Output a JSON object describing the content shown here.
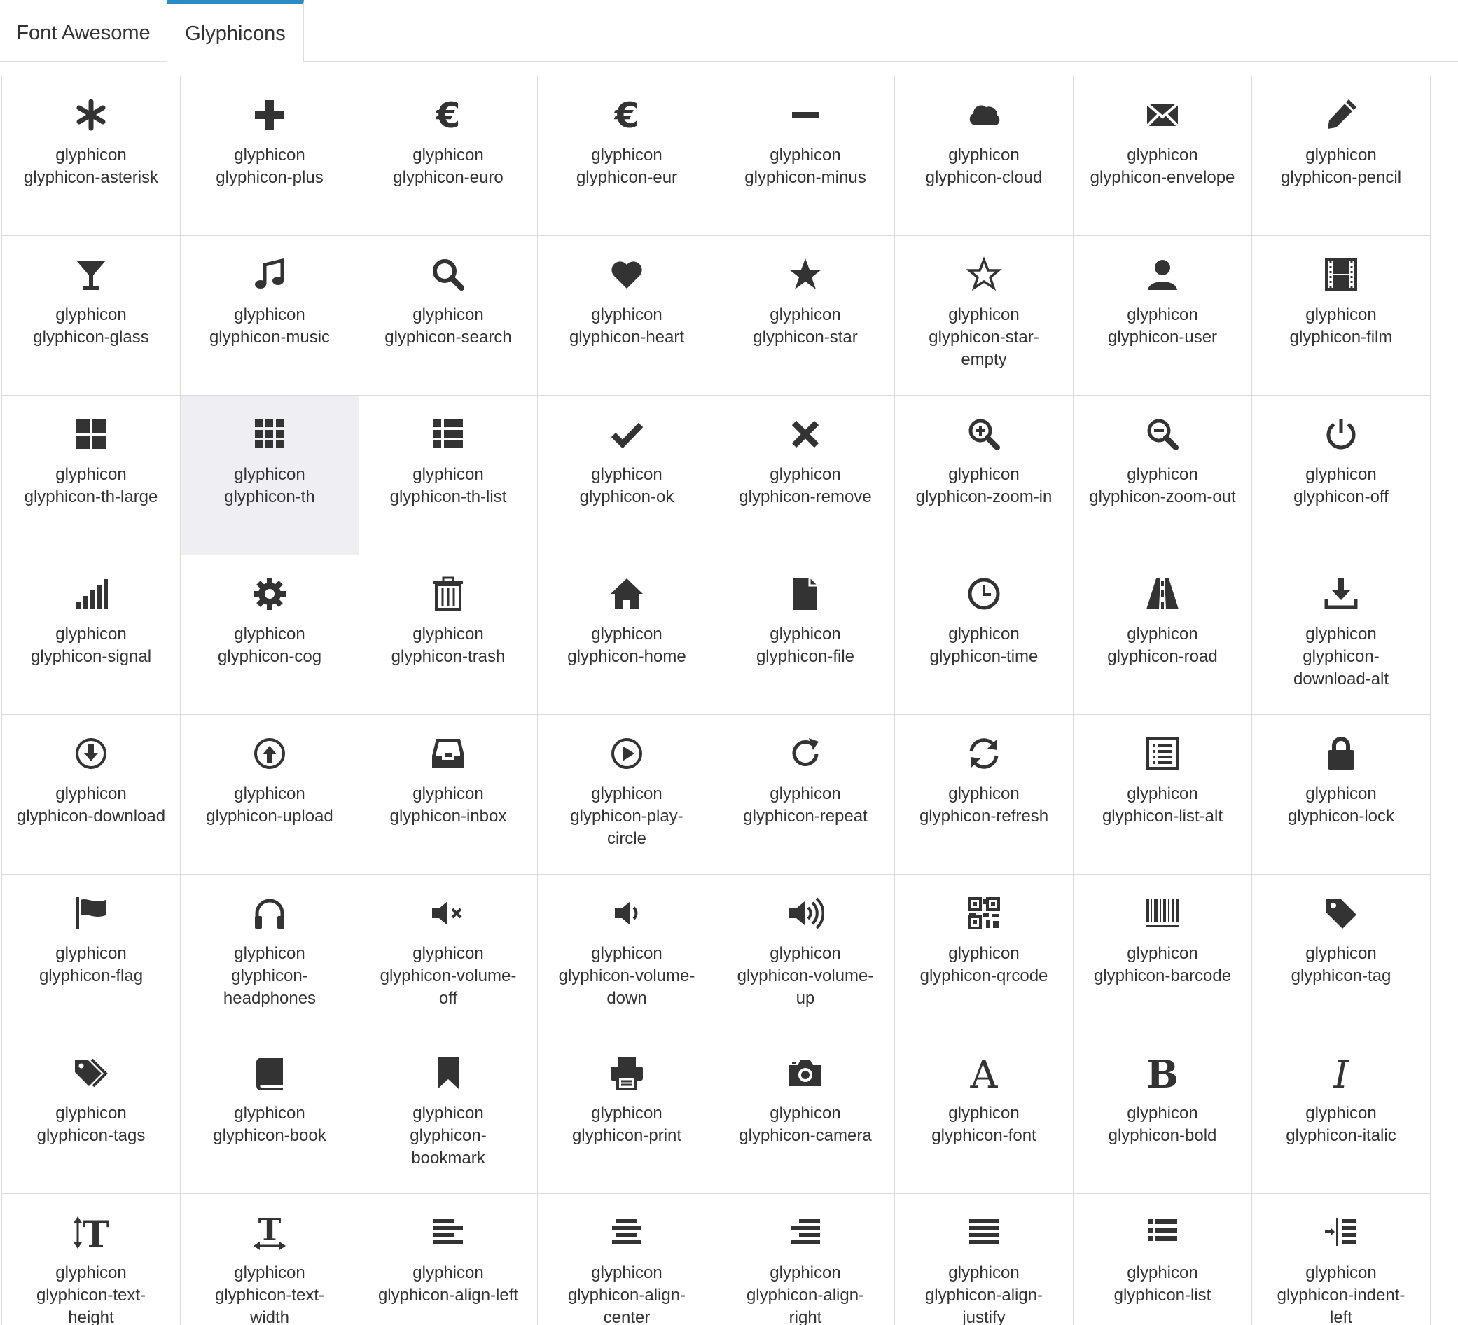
{
  "tabs": [
    {
      "label": "Font Awesome",
      "active": false
    },
    {
      "label": "Glyphicons",
      "active": true
    }
  ],
  "accent_color": "#2b8cc4",
  "hover_color": "#efeef3",
  "icons": [
    {
      "name": "asterisk",
      "line1": "glyphicon",
      "line2": "glyphicon-asterisk",
      "line3": ""
    },
    {
      "name": "plus",
      "line1": "glyphicon",
      "line2": "glyphicon-plus",
      "line3": ""
    },
    {
      "name": "euro",
      "line1": "glyphicon",
      "line2": "glyphicon-euro",
      "line3": ""
    },
    {
      "name": "eur",
      "line1": "glyphicon",
      "line2": "glyphicon-eur",
      "line3": ""
    },
    {
      "name": "minus",
      "line1": "glyphicon",
      "line2": "glyphicon-minus",
      "line3": ""
    },
    {
      "name": "cloud",
      "line1": "glyphicon",
      "line2": "glyphicon-cloud",
      "line3": ""
    },
    {
      "name": "envelope",
      "line1": "glyphicon",
      "line2": "glyphicon-envelope",
      "line3": ""
    },
    {
      "name": "pencil",
      "line1": "glyphicon",
      "line2": "glyphicon-pencil",
      "line3": ""
    },
    {
      "name": "glass",
      "line1": "glyphicon",
      "line2": "glyphicon-glass",
      "line3": ""
    },
    {
      "name": "music",
      "line1": "glyphicon",
      "line2": "glyphicon-music",
      "line3": ""
    },
    {
      "name": "search",
      "line1": "glyphicon",
      "line2": "glyphicon-search",
      "line3": ""
    },
    {
      "name": "heart",
      "line1": "glyphicon",
      "line2": "glyphicon-heart",
      "line3": ""
    },
    {
      "name": "star",
      "line1": "glyphicon",
      "line2": "glyphicon-star",
      "line3": ""
    },
    {
      "name": "star-empty",
      "line1": "glyphicon",
      "line2": "glyphicon-star-",
      "line3": "empty"
    },
    {
      "name": "user",
      "line1": "glyphicon",
      "line2": "glyphicon-user",
      "line3": ""
    },
    {
      "name": "film",
      "line1": "glyphicon",
      "line2": "glyphicon-film",
      "line3": ""
    },
    {
      "name": "th-large",
      "line1": "glyphicon",
      "line2": "glyphicon-th-large",
      "line3": ""
    },
    {
      "name": "th",
      "line1": "glyphicon",
      "line2": "glyphicon-th",
      "line3": "",
      "hover": true
    },
    {
      "name": "th-list",
      "line1": "glyphicon",
      "line2": "glyphicon-th-list",
      "line3": ""
    },
    {
      "name": "ok",
      "line1": "glyphicon",
      "line2": "glyphicon-ok",
      "line3": ""
    },
    {
      "name": "remove",
      "line1": "glyphicon",
      "line2": "glyphicon-remove",
      "line3": ""
    },
    {
      "name": "zoom-in",
      "line1": "glyphicon",
      "line2": "glyphicon-zoom-in",
      "line3": ""
    },
    {
      "name": "zoom-out",
      "line1": "glyphicon",
      "line2": "glyphicon-zoom-out",
      "line3": ""
    },
    {
      "name": "off",
      "line1": "glyphicon",
      "line2": "glyphicon-off",
      "line3": ""
    },
    {
      "name": "signal",
      "line1": "glyphicon",
      "line2": "glyphicon-signal",
      "line3": ""
    },
    {
      "name": "cog",
      "line1": "glyphicon",
      "line2": "glyphicon-cog",
      "line3": ""
    },
    {
      "name": "trash",
      "line1": "glyphicon",
      "line2": "glyphicon-trash",
      "line3": ""
    },
    {
      "name": "home",
      "line1": "glyphicon",
      "line2": "glyphicon-home",
      "line3": ""
    },
    {
      "name": "file",
      "line1": "glyphicon",
      "line2": "glyphicon-file",
      "line3": ""
    },
    {
      "name": "time",
      "line1": "glyphicon",
      "line2": "glyphicon-time",
      "line3": ""
    },
    {
      "name": "road",
      "line1": "glyphicon",
      "line2": "glyphicon-road",
      "line3": ""
    },
    {
      "name": "download-alt",
      "line1": "glyphicon",
      "line2": "glyphicon-",
      "line3": "download-alt"
    },
    {
      "name": "download",
      "line1": "glyphicon",
      "line2": "glyphicon-download",
      "line3": ""
    },
    {
      "name": "upload",
      "line1": "glyphicon",
      "line2": "glyphicon-upload",
      "line3": ""
    },
    {
      "name": "inbox",
      "line1": "glyphicon",
      "line2": "glyphicon-inbox",
      "line3": ""
    },
    {
      "name": "play-circle",
      "line1": "glyphicon",
      "line2": "glyphicon-play-",
      "line3": "circle"
    },
    {
      "name": "repeat",
      "line1": "glyphicon",
      "line2": "glyphicon-repeat",
      "line3": ""
    },
    {
      "name": "refresh",
      "line1": "glyphicon",
      "line2": "glyphicon-refresh",
      "line3": ""
    },
    {
      "name": "list-alt",
      "line1": "glyphicon",
      "line2": "glyphicon-list-alt",
      "line3": ""
    },
    {
      "name": "lock",
      "line1": "glyphicon",
      "line2": "glyphicon-lock",
      "line3": ""
    },
    {
      "name": "flag",
      "line1": "glyphicon",
      "line2": "glyphicon-flag",
      "line3": ""
    },
    {
      "name": "headphones",
      "line1": "glyphicon",
      "line2": "glyphicon-",
      "line3": "headphones"
    },
    {
      "name": "volume-off",
      "line1": "glyphicon",
      "line2": "glyphicon-volume-",
      "line3": "off"
    },
    {
      "name": "volume-down",
      "line1": "glyphicon",
      "line2": "glyphicon-volume-",
      "line3": "down"
    },
    {
      "name": "volume-up",
      "line1": "glyphicon",
      "line2": "glyphicon-volume-",
      "line3": "up"
    },
    {
      "name": "qrcode",
      "line1": "glyphicon",
      "line2": "glyphicon-qrcode",
      "line3": ""
    },
    {
      "name": "barcode",
      "line1": "glyphicon",
      "line2": "glyphicon-barcode",
      "line3": ""
    },
    {
      "name": "tag",
      "line1": "glyphicon",
      "line2": "glyphicon-tag",
      "line3": ""
    },
    {
      "name": "tags",
      "line1": "glyphicon",
      "line2": "glyphicon-tags",
      "line3": ""
    },
    {
      "name": "book",
      "line1": "glyphicon",
      "line2": "glyphicon-book",
      "line3": ""
    },
    {
      "name": "bookmark",
      "line1": "glyphicon",
      "line2": "glyphicon-",
      "line3": "bookmark"
    },
    {
      "name": "print",
      "line1": "glyphicon",
      "line2": "glyphicon-print",
      "line3": ""
    },
    {
      "name": "camera",
      "line1": "glyphicon",
      "line2": "glyphicon-camera",
      "line3": ""
    },
    {
      "name": "font",
      "line1": "glyphicon",
      "line2": "glyphicon-font",
      "line3": ""
    },
    {
      "name": "bold",
      "line1": "glyphicon",
      "line2": "glyphicon-bold",
      "line3": ""
    },
    {
      "name": "italic",
      "line1": "glyphicon",
      "line2": "glyphicon-italic",
      "line3": ""
    },
    {
      "name": "text-height",
      "line1": "glyphicon",
      "line2": "glyphicon-text-",
      "line3": "height"
    },
    {
      "name": "text-width",
      "line1": "glyphicon",
      "line2": "glyphicon-text-",
      "line3": "width"
    },
    {
      "name": "align-left",
      "line1": "glyphicon",
      "line2": "glyphicon-align-left",
      "line3": ""
    },
    {
      "name": "align-center",
      "line1": "glyphicon",
      "line2": "glyphicon-align-",
      "line3": "center"
    },
    {
      "name": "align-right",
      "line1": "glyphicon",
      "line2": "glyphicon-align-",
      "line3": "right"
    },
    {
      "name": "align-justify",
      "line1": "glyphicon",
      "line2": "glyphicon-align-",
      "line3": "justify"
    },
    {
      "name": "list",
      "line1": "glyphicon",
      "line2": "glyphicon-list",
      "line3": ""
    },
    {
      "name": "indent-left",
      "line1": "glyphicon",
      "line2": "glyphicon-indent-",
      "line3": "left"
    }
  ]
}
